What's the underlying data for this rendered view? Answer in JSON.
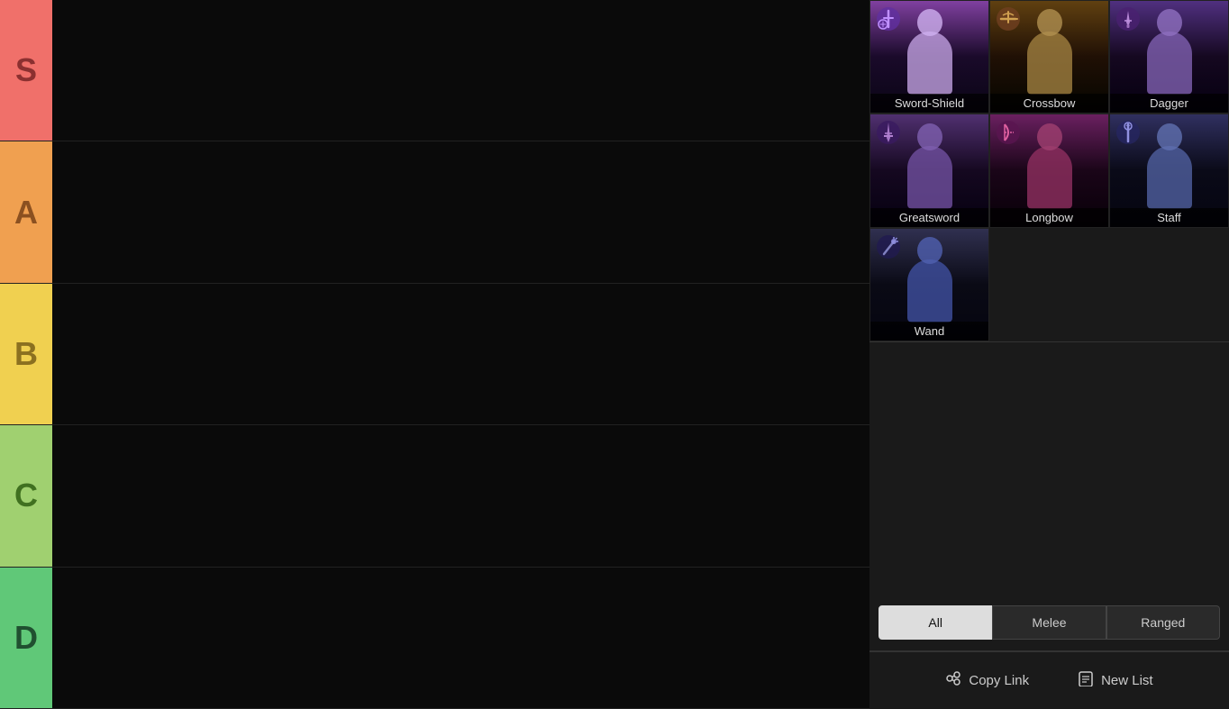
{
  "tiers": [
    {
      "id": "s",
      "label": "S",
      "color": "#f0706a",
      "textColor": "#8b3030"
    },
    {
      "id": "a",
      "label": "A",
      "color": "#f0a050",
      "textColor": "#8b5020"
    },
    {
      "id": "b",
      "label": "B",
      "color": "#f0d050",
      "textColor": "#8b7020"
    },
    {
      "id": "c",
      "label": "C",
      "color": "#a0d070",
      "textColor": "#407020"
    },
    {
      "id": "d",
      "label": "D",
      "color": "#60c878",
      "textColor": "#205030"
    }
  ],
  "weapons": [
    {
      "id": "sword-shield",
      "name": "Sword-Shield",
      "type": "melee"
    },
    {
      "id": "crossbow",
      "name": "Crossbow",
      "type": "ranged"
    },
    {
      "id": "dagger",
      "name": "Dagger",
      "type": "melee"
    },
    {
      "id": "greatsword",
      "name": "Greatsword",
      "type": "melee"
    },
    {
      "id": "longbow",
      "name": "Longbow",
      "type": "ranged"
    },
    {
      "id": "staff",
      "name": "Staff",
      "type": "ranged"
    },
    {
      "id": "wand",
      "name": "Wand",
      "type": "ranged"
    }
  ],
  "filters": [
    {
      "id": "all",
      "label": "All",
      "active": true
    },
    {
      "id": "melee",
      "label": "Melee",
      "active": false
    },
    {
      "id": "ranged",
      "label": "Ranged",
      "active": false
    }
  ],
  "actions": {
    "copy_link": "Copy Link",
    "new_list": "New List"
  }
}
